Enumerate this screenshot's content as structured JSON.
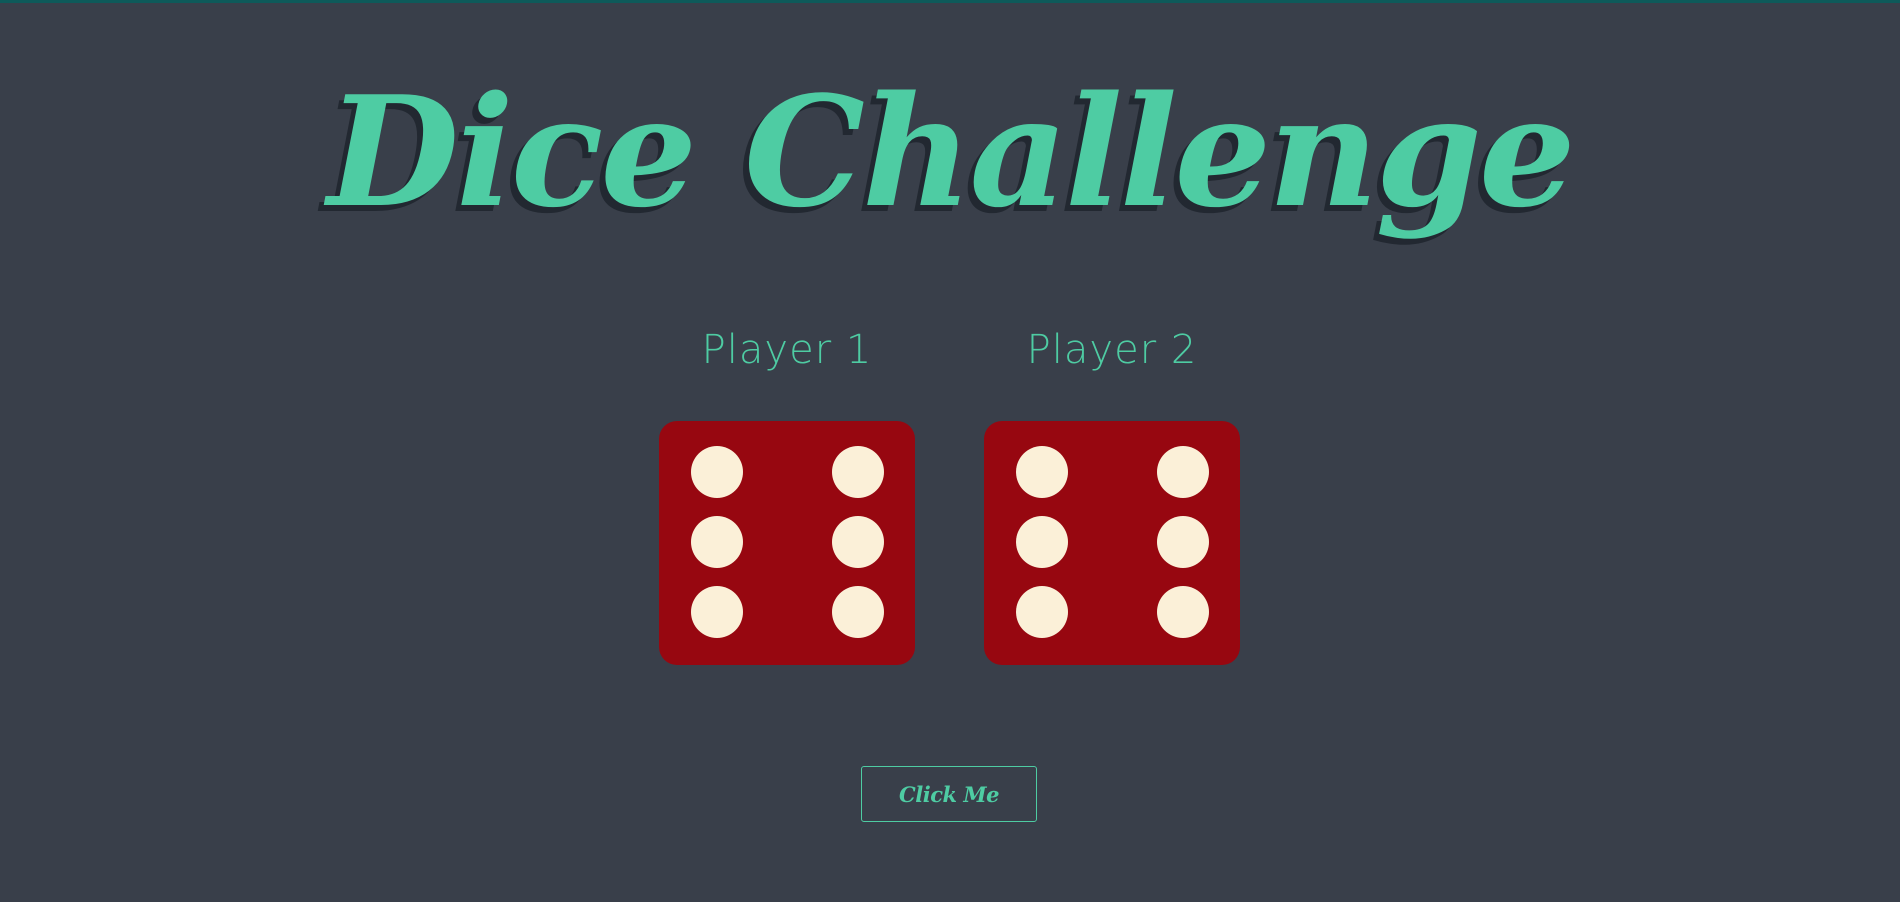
{
  "page": {
    "title": "Dice Challenge",
    "accent_color": "#4ecca3",
    "background_color": "#393f4a",
    "die_color": "#970710",
    "pip_color": "#fbf0d8"
  },
  "players": [
    {
      "label": "Player 1",
      "die_value": 6
    },
    {
      "label": "Player 2",
      "die_value": 6
    }
  ],
  "button": {
    "label": "Click Me"
  }
}
